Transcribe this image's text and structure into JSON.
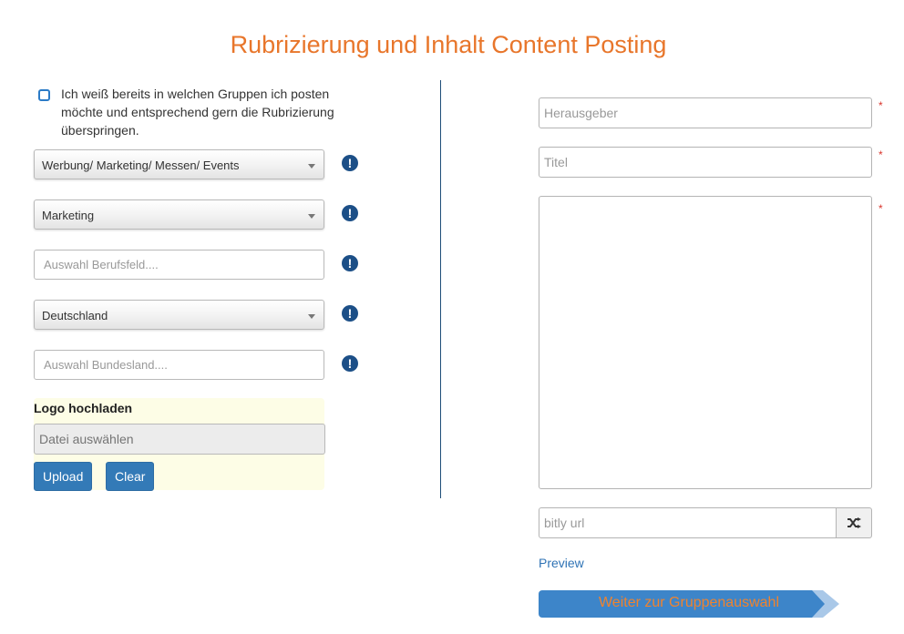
{
  "page": {
    "title": "Rubrizierung und Inhalt Content Posting"
  },
  "left": {
    "skip_checkbox_label": "Ich weiß bereits in welchen Gruppen ich posten möchte und entsprechend gern die Rubrizierung überspringen.",
    "category_select": "Werbung/ Marketing/ Messen/ Events",
    "subcategory_select": "Marketing",
    "berufsfeld_placeholder": "Auswahl Berufsfeld....",
    "country_select": "Deutschland",
    "bundesland_placeholder": "Auswahl Bundesland....",
    "warning_symbol": "!",
    "logo": {
      "title": "Logo hochladen",
      "file_placeholder": "Datei auswählen",
      "upload_label": "Upload",
      "clear_label": "Clear"
    }
  },
  "right": {
    "herausgeber_placeholder": "Herausgeber",
    "titel_placeholder": "Titel",
    "required_marker": "*",
    "bitly_placeholder": "bitly url",
    "preview_label": "Preview",
    "next_label": "Weiter zur Gruppenauswahl"
  },
  "colors": {
    "accent_orange": "#e8762b",
    "primary_blue": "#337ab7",
    "warning_icon": "#1c4f87",
    "required_red": "#d9342b"
  },
  "icons": {
    "warning": "exclamation-circle-icon",
    "shuffle": "shuffle-icon",
    "select_caret": "caret-down-icon"
  }
}
